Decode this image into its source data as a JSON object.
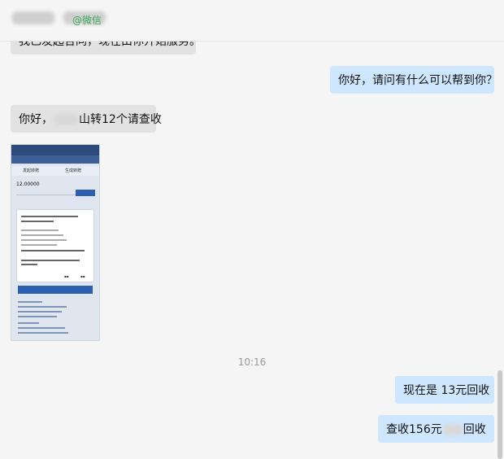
{
  "header": {
    "title_prefix": "",
    "title_visible_suffix": "",
    "source": "@微信"
  },
  "messages": {
    "m0": {
      "text": "我已发起合同，现在由你开始服务。"
    },
    "m1": {
      "text": "你好，请问有什么可以帮到你？"
    },
    "m2": {
      "prefix": "你好，",
      "suffix": "山转12个请查收"
    },
    "m3": {
      "text": "现在是  13元回收"
    },
    "m4": {
      "prefix": "查收156元",
      "suffix": "回收"
    }
  },
  "timestamp": "10:16",
  "shot": {
    "tab1": "发起转赠",
    "tab2": "生成转赠",
    "amount": "12.00000",
    "confirm": "确认"
  },
  "colors": {
    "background": "#f5f5f5",
    "left_bubble": "#e2e2e2",
    "right_bubble": "#cfe6ff",
    "source_green": "#3aa85a"
  }
}
